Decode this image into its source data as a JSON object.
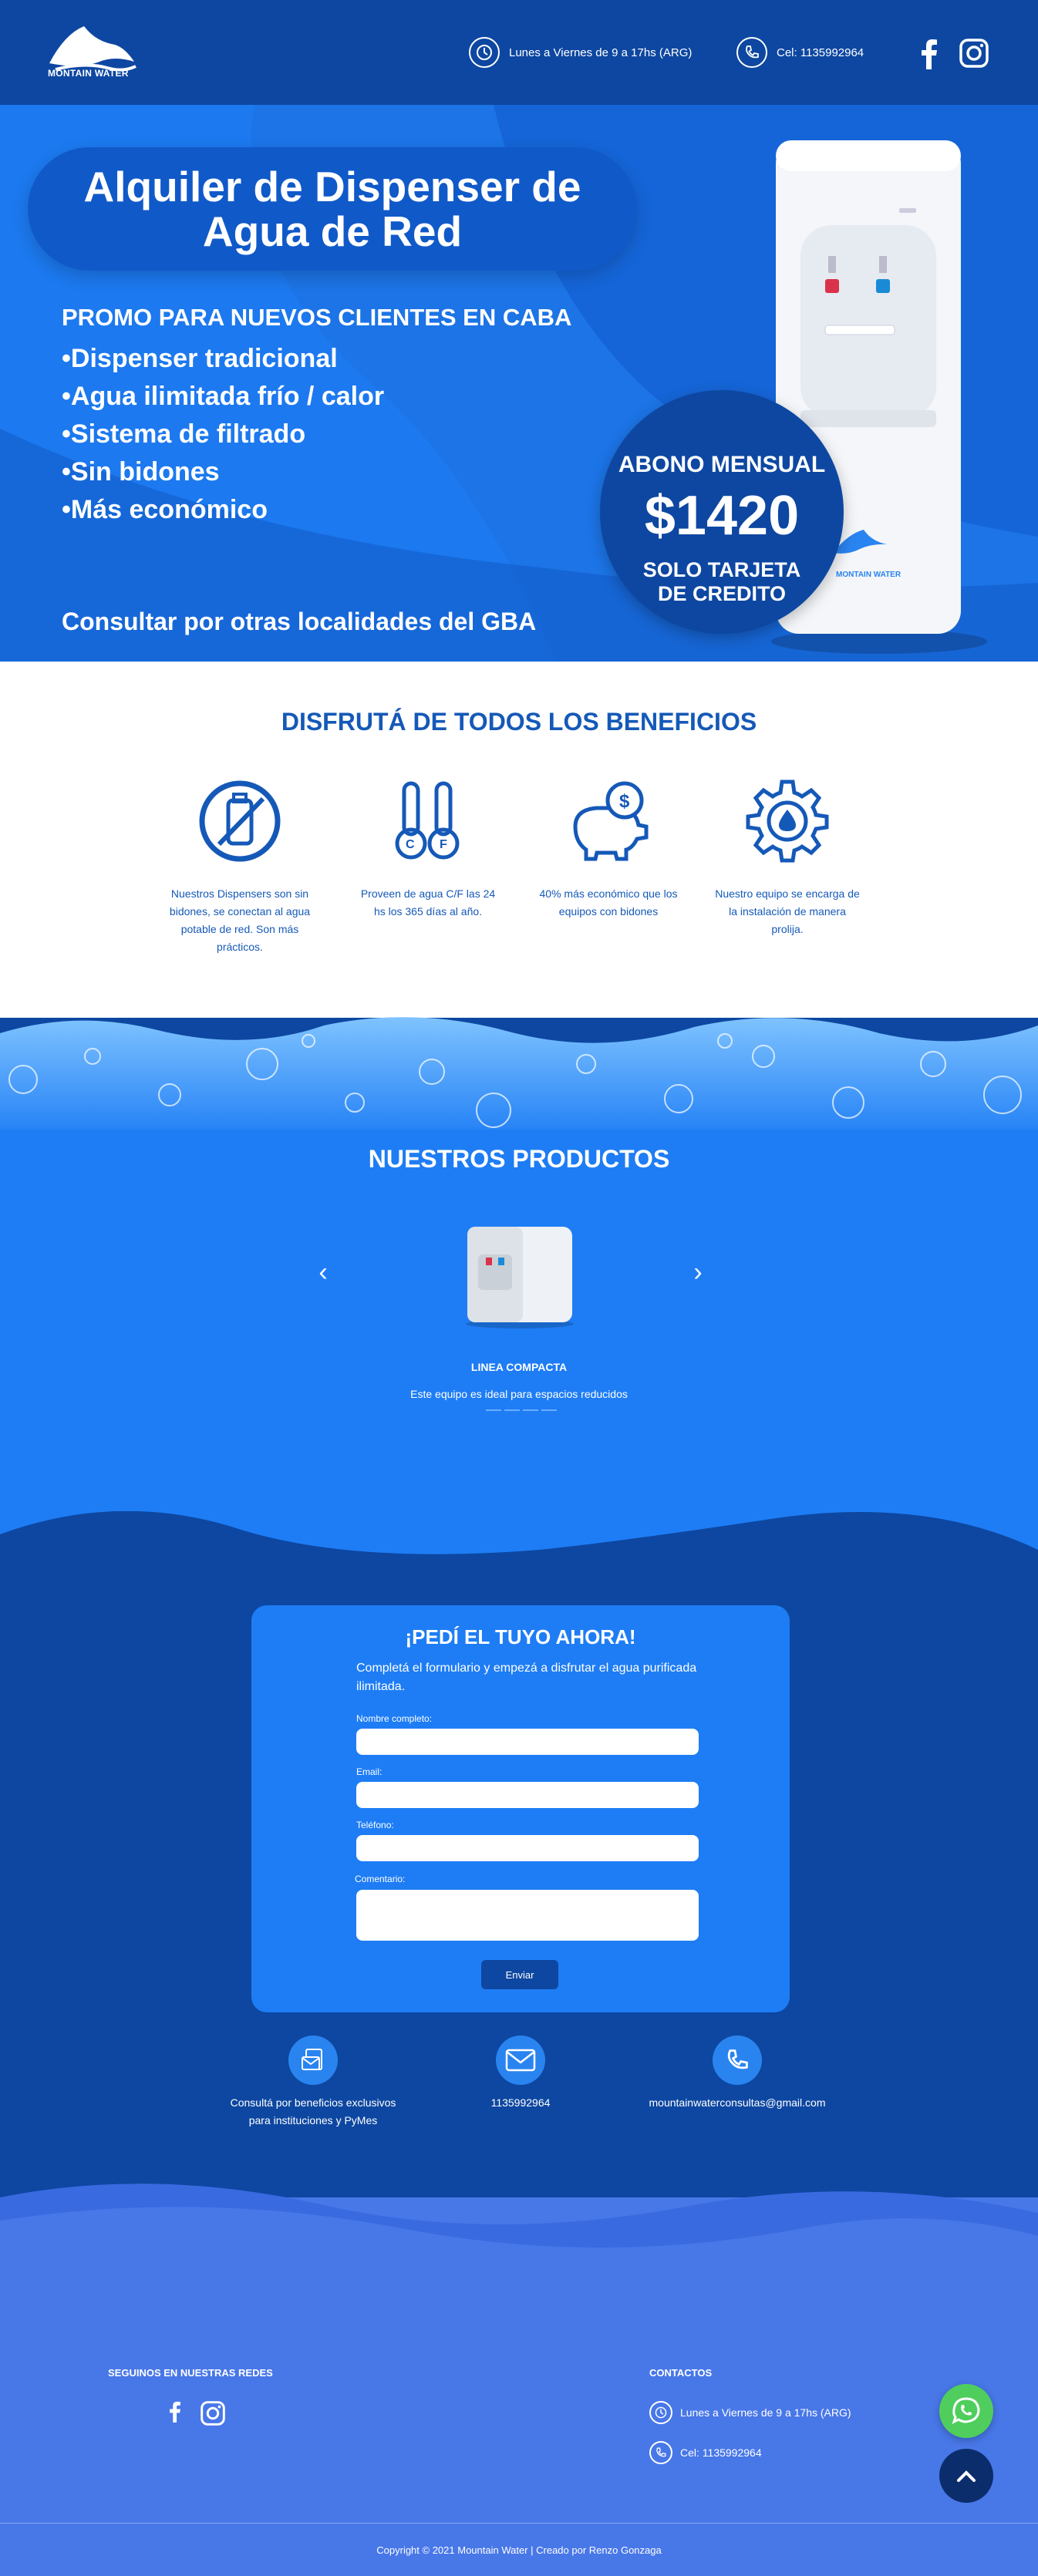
{
  "header": {
    "brand": "MONTAIN WATER",
    "hours": "Lunes a Viernes de 9 a 17hs (ARG)",
    "phone": "Cel: 1135992964"
  },
  "hero": {
    "title": "Alquiler de Dispenser de Agua de Red",
    "promo": "PROMO PARA NUEVOS CLIENTES EN CABA",
    "features": [
      "•Dispenser tradicional",
      "•Agua ilimitada frío / calor",
      "•Sistema de filtrado",
      "•Sin bidones",
      "•Más económico"
    ],
    "cta": "Consultar por otras localidades del GBA",
    "abono_label": "ABONO MENSUAL",
    "abono_price": "$1420",
    "abono_note": "SOLO TARJETA DE CREDITO"
  },
  "benefits": {
    "title": "DISFRUTÁ DE TODOS LOS BENEFICIOS",
    "items": [
      {
        "icon": "no-bottle-icon",
        "text": "Nuestros Dispensers son sin bidones, se conectan al agua potable de red. Son más prácticos."
      },
      {
        "icon": "thermometer-icon",
        "text": "Proveen de agua C/F las 24 hs los 365 días al año."
      },
      {
        "icon": "piggy-bank-icon",
        "text": "40% más económico que los equipos con bidones"
      },
      {
        "icon": "gear-drop-icon",
        "text": "Nuestro equipo se encarga de la instalación de manera prolija."
      }
    ]
  },
  "products": {
    "title": "NUESTROS PRODUCTOS",
    "current": {
      "name": "LINEA COMPACTA",
      "description": "Este equipo es ideal para espacios reducidos"
    },
    "slides": 4
  },
  "order": {
    "title": "¡PEDÍ EL TUYO AHORA!",
    "intro": "Completá el formulario y empezá a disfrutar el agua purificada ilimitada.",
    "labels": {
      "name": "Nombre completo:",
      "email": "Email:",
      "phone": "Teléfono:",
      "comment": "Comentario:"
    },
    "submit": "Enviar",
    "contacts": [
      {
        "icon": "mail-form-icon",
        "text": "Consultá por beneficios exclusivos para instituciones y PyMes"
      },
      {
        "icon": "envelope-icon",
        "text": "1135992964"
      },
      {
        "icon": "phone-icon",
        "text": "mountainwaterconsultas@gmail.com"
      }
    ]
  },
  "footer": {
    "social_title": "SEGUINOS EN NUESTRAS REDES",
    "contact_title": "CONTACTOS",
    "hours": "Lunes a Viernes de 9 a 17hs (ARG)",
    "phone": "Cel: 1135992964",
    "copyright": "Copyright © 2021 Mountain Water | Creado por Renzo Gonzaga"
  },
  "colors": {
    "primary": "#0d47a1",
    "hero": "#1565d8",
    "bright": "#1e7df5",
    "footer": "#4877e8",
    "whatsapp": "#4fce5d"
  }
}
